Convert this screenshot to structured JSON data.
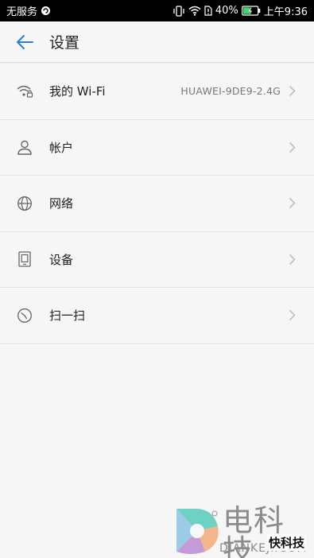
{
  "status_bar": {
    "carrier": "无服务",
    "battery": "40%",
    "time": "上午9:36"
  },
  "app_bar": {
    "title": "设置"
  },
  "items": [
    {
      "label": "我的 Wi-Fi",
      "value": "HUAWEI-9DE9-2.4G",
      "icon": "wifi-lock-icon"
    },
    {
      "label": "帐户",
      "value": "",
      "icon": "person-icon"
    },
    {
      "label": "网络",
      "value": "",
      "icon": "globe-icon"
    },
    {
      "label": "设备",
      "value": "",
      "icon": "device-icon"
    },
    {
      "label": "扫一扫",
      "value": "",
      "icon": "scan-icon"
    }
  ],
  "watermark": {
    "brand": "电科技",
    "domain": "DIANKEJI.COM",
    "badge": "快科技"
  },
  "colors": {
    "accent": "#2a7fd4",
    "background": "#f6f6f6"
  }
}
